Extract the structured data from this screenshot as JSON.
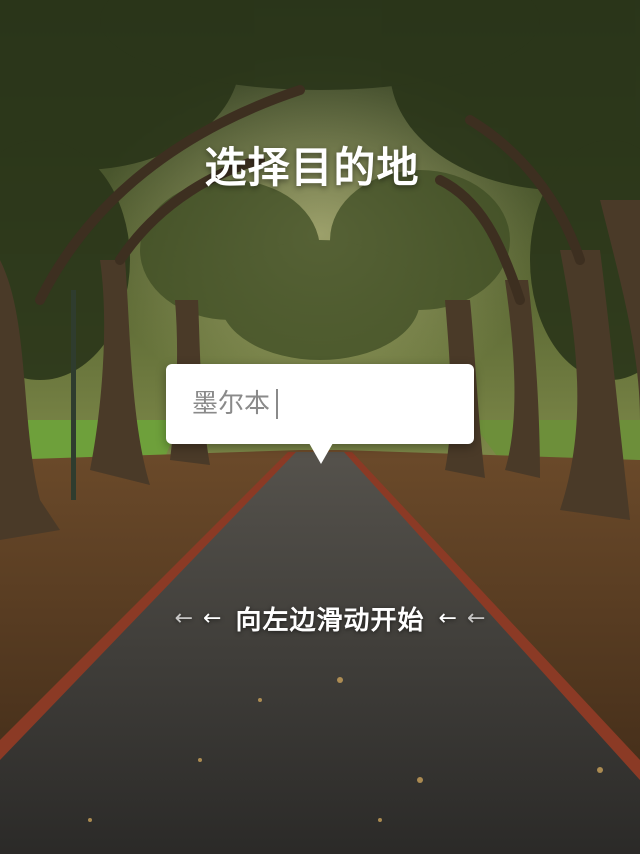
{
  "screen": {
    "title": "选择目的地"
  },
  "search": {
    "value": "墨尔本"
  },
  "hint": {
    "text": "向左边滑动开始",
    "left_arrow": "←",
    "right_arrow": "←"
  },
  "background": {
    "description_icon": "park-path-background",
    "colors": {
      "sky": "#b9b18a",
      "foliage_dark": "#2d3a1c",
      "foliage_mid": "#4e5b2c",
      "grass": "#6fa23a",
      "path": "#3a3938",
      "path_edge": "#8b3a25",
      "ground": "#5a3b22"
    }
  }
}
